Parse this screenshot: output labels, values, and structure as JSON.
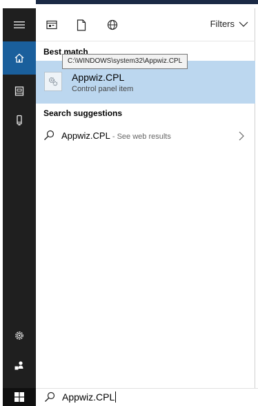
{
  "toolbar": {
    "icons": [
      "apps-filter-icon",
      "documents-filter-icon",
      "web-filter-icon"
    ],
    "filters_label": "Filters"
  },
  "rail": {
    "items": [
      "menu-icon",
      "home-icon",
      "notebook-icon",
      "device-icon",
      "settings-icon",
      "feedback-icon"
    ],
    "active": "home-icon"
  },
  "best_match": {
    "heading": "Best match",
    "tooltip": "C:\\WINDOWS\\system32\\Appwiz.CPL",
    "title": "Appwiz.CPL",
    "subtitle": "Control panel item"
  },
  "suggestions": {
    "heading": "Search suggestions",
    "items": [
      {
        "label": "Appwiz.CPL",
        "hint": " - See web results"
      }
    ]
  },
  "search": {
    "value": "Appwiz.CPL"
  },
  "colors": {
    "rail_bg": "#1f1f1f",
    "rail_active": "#1a5f9c",
    "selected_item": "#bcd7ef",
    "taskbar": "#101010"
  }
}
